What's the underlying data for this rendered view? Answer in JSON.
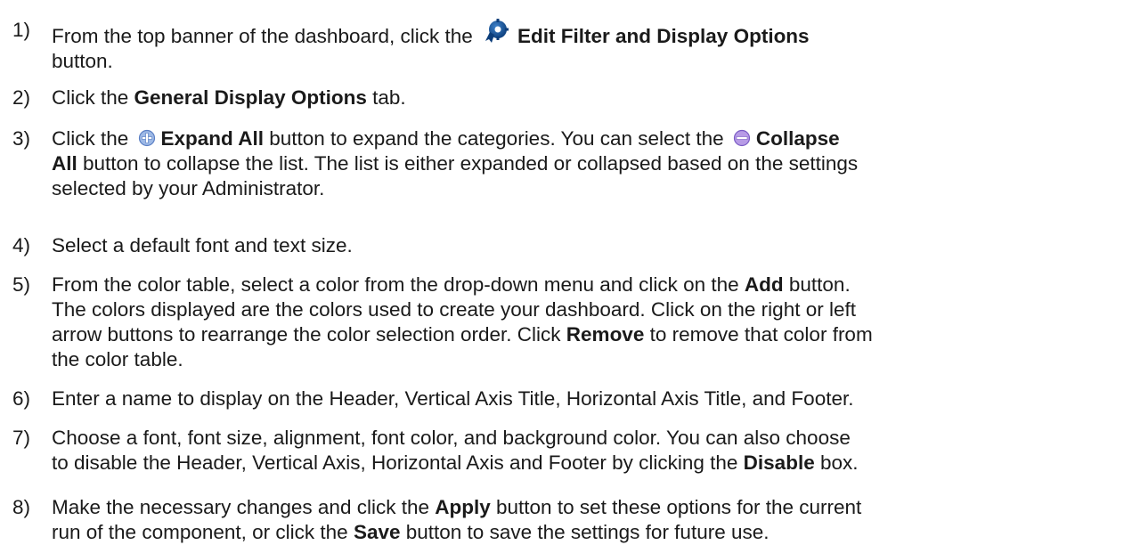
{
  "steps": [
    {
      "number": "1)",
      "parts": [
        {
          "t": "text",
          "v": "From the top banner of the dashboard, click the "
        },
        {
          "t": "icon",
          "v": "edit-filter-gear-icon"
        },
        {
          "t": "bold",
          "v": "Edit Filter and Display Options"
        },
        {
          "t": "br"
        },
        {
          "t": "text",
          "v": "button."
        }
      ]
    },
    {
      "number": "2)",
      "parts": [
        {
          "t": "text",
          "v": "Click the "
        },
        {
          "t": "bold",
          "v": "General Display Options"
        },
        {
          "t": "text",
          "v": " tab."
        }
      ]
    },
    {
      "number": "3)",
      "parts": [
        {
          "t": "text",
          "v": "Click the "
        },
        {
          "t": "icon",
          "v": "expand-all-plus-icon"
        },
        {
          "t": "bold",
          "v": "Expand All"
        },
        {
          "t": "text",
          "v": " button to expand the categories. You can select the "
        },
        {
          "t": "icon",
          "v": "collapse-all-minus-icon"
        },
        {
          "t": "bold",
          "v": "Collapse"
        },
        {
          "t": "br"
        },
        {
          "t": "bold",
          "v": "All"
        },
        {
          "t": "text",
          "v": " button to collapse the list. The list is either expanded or collapsed based on the settings"
        },
        {
          "t": "br"
        },
        {
          "t": "text",
          "v": "selected by your Administrator."
        }
      ]
    },
    {
      "number": "4)",
      "parts": [
        {
          "t": "text",
          "v": "Select a default font and text size."
        }
      ]
    },
    {
      "number": "5)",
      "parts": [
        {
          "t": "text",
          "v": "From the color table, select a color from the drop-down menu and click on the "
        },
        {
          "t": "bold",
          "v": "Add"
        },
        {
          "t": "text",
          "v": " button."
        },
        {
          "t": "br"
        },
        {
          "t": "text",
          "v": "The colors displayed are the colors used to create your dashboard. Click on the right or left"
        },
        {
          "t": "br"
        },
        {
          "t": "text",
          "v": "arrow buttons to rearrange the color selection order. Click "
        },
        {
          "t": "bold",
          "v": "Remove"
        },
        {
          "t": "text",
          "v": " to remove that color from"
        },
        {
          "t": "br"
        },
        {
          "t": "text",
          "v": "the color table."
        }
      ]
    },
    {
      "number": "6)",
      "parts": [
        {
          "t": "text",
          "v": "Enter a name to display on the Header, Vertical Axis Title, Horizontal Axis Title, and Footer."
        }
      ]
    },
    {
      "number": "7)",
      "parts": [
        {
          "t": "text",
          "v": "Choose a font, font size, alignment, font color, and background color. You can also choose"
        },
        {
          "t": "br"
        },
        {
          "t": "text",
          "v": "to disable the Header, Vertical Axis, Horizontal Axis and Footer by clicking the "
        },
        {
          "t": "bold",
          "v": "Disable"
        },
        {
          "t": "text",
          "v": " box."
        }
      ]
    },
    {
      "number": "8)",
      "parts": [
        {
          "t": "text",
          "v": "Make the necessary changes and click the "
        },
        {
          "t": "bold",
          "v": "Apply"
        },
        {
          "t": "text",
          "v": " button to set these options for the current"
        },
        {
          "t": "br"
        },
        {
          "t": "text",
          "v": "run of the component, or click the "
        },
        {
          "t": "bold",
          "v": "Save"
        },
        {
          "t": "text",
          "v": " button to save the settings for future use."
        }
      ]
    }
  ]
}
